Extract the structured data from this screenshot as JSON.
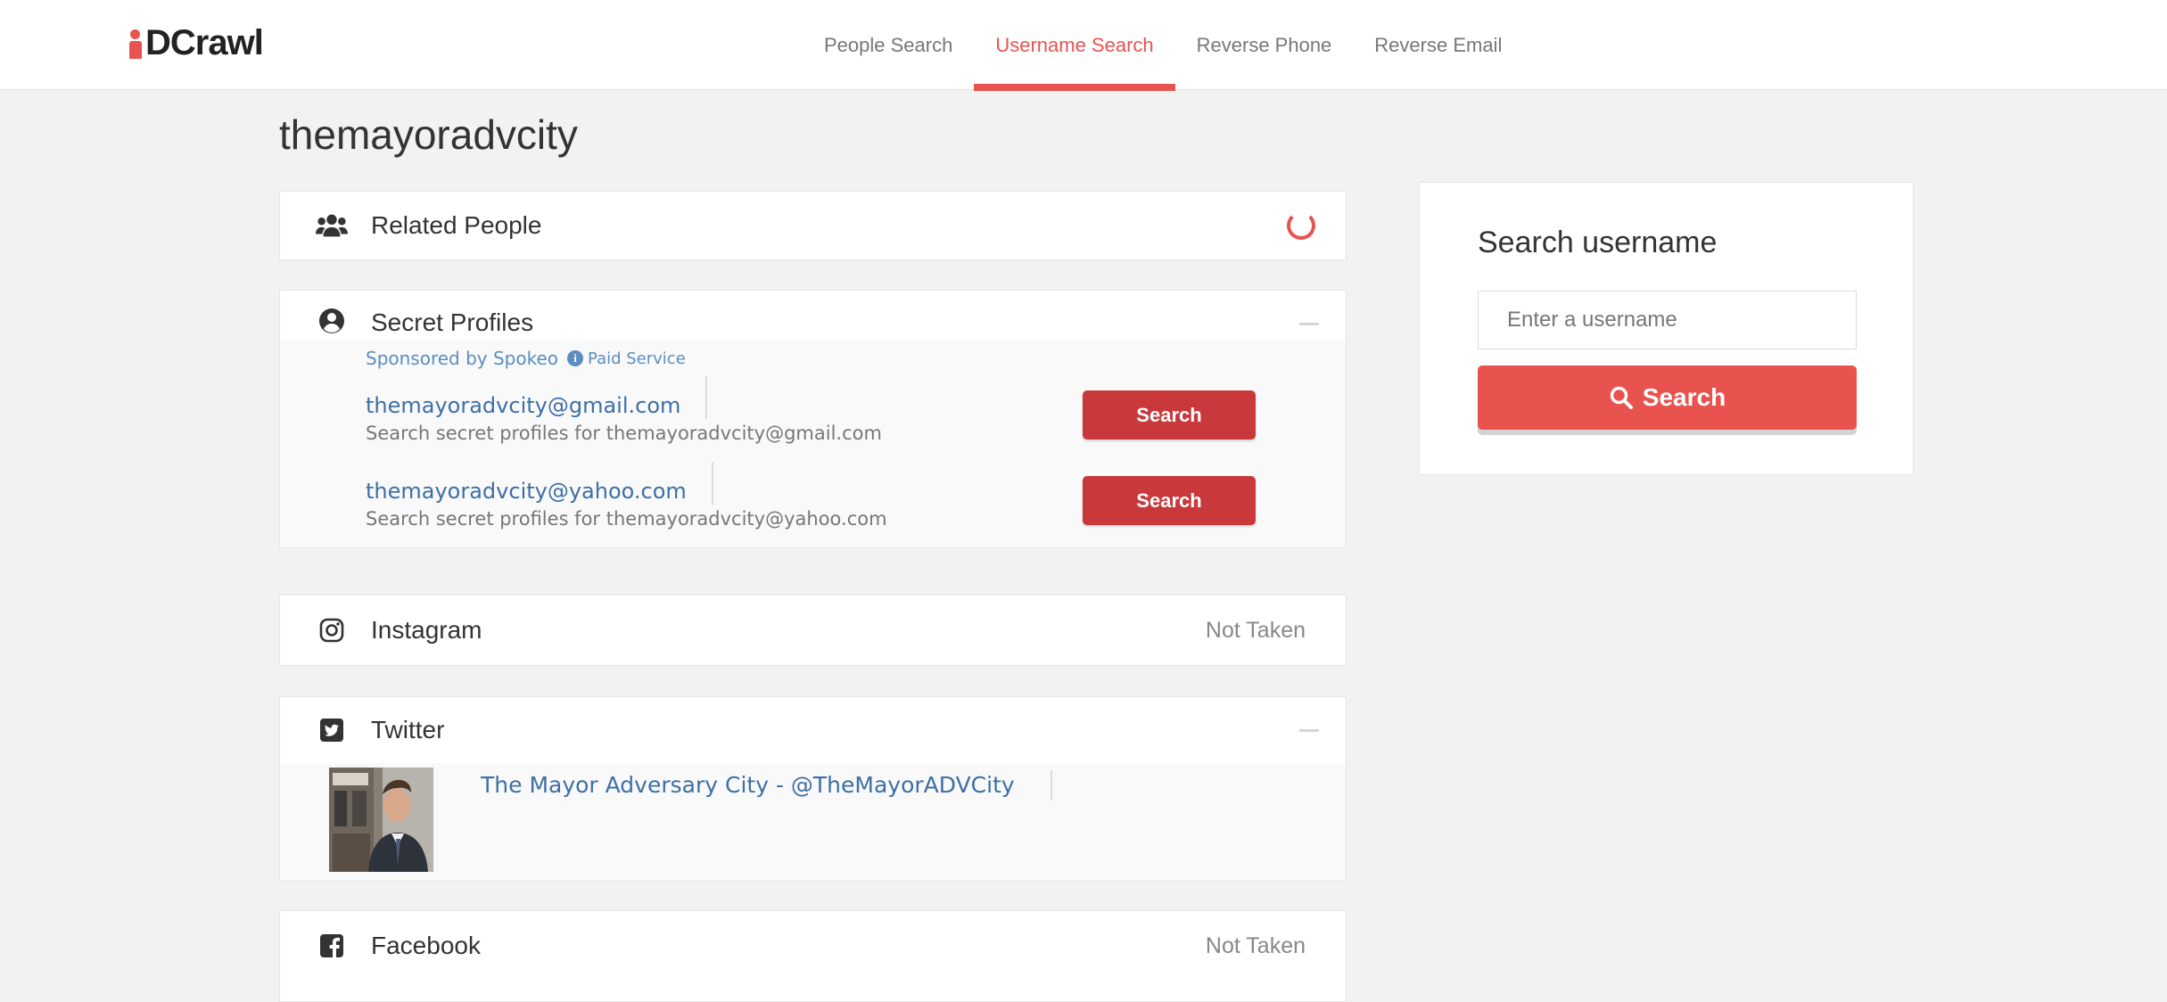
{
  "brand": {
    "name": "DCrawl",
    "accent_color": "#e8534f"
  },
  "nav": {
    "tabs": [
      {
        "label": "People Search"
      },
      {
        "label": "Username Search",
        "active": true
      },
      {
        "label": "Reverse Phone"
      },
      {
        "label": "Reverse Email"
      }
    ]
  },
  "page": {
    "title": "themayoradvcity"
  },
  "sections": {
    "related_people": {
      "title": "Related People",
      "icon": "users-icon",
      "status": "loading"
    },
    "secret_profiles": {
      "title": "Secret Profiles",
      "icon": "user-circle-icon",
      "sponsored_text": "Sponsored by Spokeo",
      "paid_label": "Paid Service",
      "items": [
        {
          "email": "themayoradvcity@gmail.com",
          "desc": "Search secret profiles for themayoradvcity@gmail.com",
          "button": "Search"
        },
        {
          "email": "themayoradvcity@yahoo.com",
          "desc": "Search secret profiles for themayoradvcity@yahoo.com",
          "button": "Search"
        }
      ]
    },
    "instagram": {
      "title": "Instagram",
      "icon": "instagram-icon",
      "status": "Not Taken"
    },
    "twitter": {
      "title": "Twitter",
      "icon": "twitter-icon",
      "profile_link": "The Mayor Adversary City - @TheMayorADVCity"
    },
    "facebook": {
      "title": "Facebook",
      "icon": "facebook-icon",
      "status": "Not Taken"
    }
  },
  "sidebar": {
    "title": "Search username",
    "input_placeholder": "Enter a username",
    "button_label": "Search"
  }
}
